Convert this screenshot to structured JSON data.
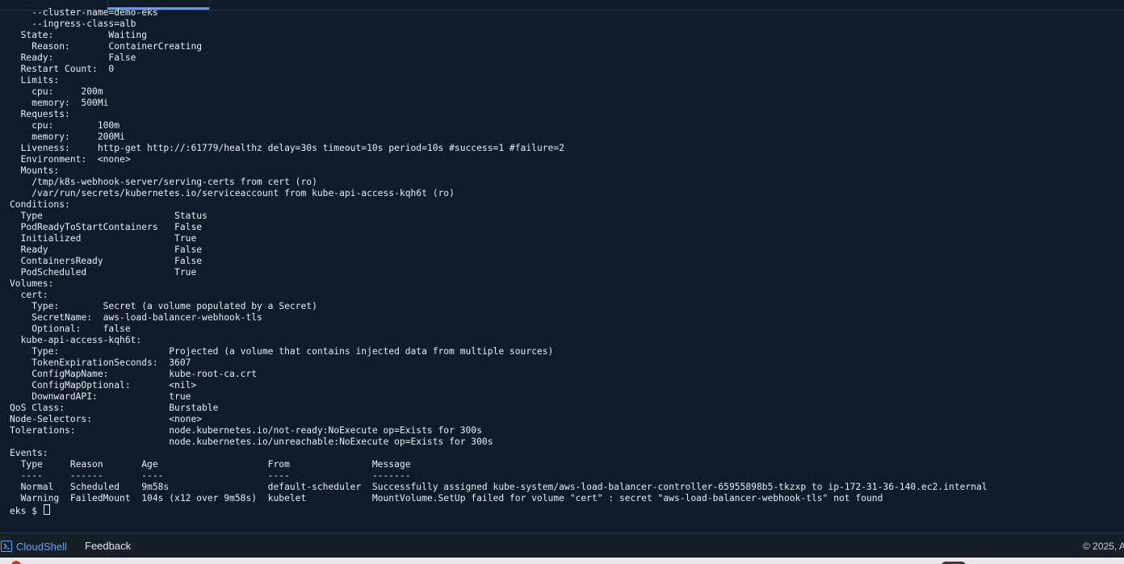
{
  "terminal": {
    "lines": [
      "    --cluster-name=demo-eks",
      "    --ingress-class=alb",
      "  State:          Waiting",
      "    Reason:       ContainerCreating",
      "  Ready:          False",
      "  Restart Count:  0",
      "  Limits:",
      "    cpu:     200m",
      "    memory:  500Mi",
      "  Requests:",
      "    cpu:        100m",
      "    memory:     200Mi",
      "  Liveness:     http-get http://:61779/healthz delay=30s timeout=10s period=10s #success=1 #failure=2",
      "  Environment:  <none>",
      "  Mounts:",
      "    /tmp/k8s-webhook-server/serving-certs from cert (ro)",
      "    /var/run/secrets/kubernetes.io/serviceaccount from kube-api-access-kqh6t (ro)",
      "Conditions:",
      "  Type                        Status",
      "  PodReadyToStartContainers   False",
      "  Initialized                 True",
      "  Ready                       False",
      "  ContainersReady             False",
      "  PodScheduled                True",
      "Volumes:",
      "  cert:",
      "    Type:        Secret (a volume populated by a Secret)",
      "    SecretName:  aws-load-balancer-webhook-tls",
      "    Optional:    false",
      "  kube-api-access-kqh6t:",
      "    Type:                    Projected (a volume that contains injected data from multiple sources)",
      "    TokenExpirationSeconds:  3607",
      "    ConfigMapName:           kube-root-ca.crt",
      "    ConfigMapOptional:       <nil>",
      "    DownwardAPI:             true",
      "QoS Class:                   Burstable",
      "Node-Selectors:              <none>",
      "Tolerations:                 node.kubernetes.io/not-ready:NoExecute op=Exists for 300s",
      "                             node.kubernetes.io/unreachable:NoExecute op=Exists for 300s",
      "Events:",
      "  Type     Reason       Age                    From               Message",
      "  ----     ------       ----                   ----               -------",
      "  Normal   Scheduled    9m58s                  default-scheduler  Successfully assigned kube-system/aws-load-balancer-controller-65955898b5-tkzxp to ip-172-31-36-140.ec2.internal",
      "  Warning  FailedMount  104s (x12 over 9m58s)  kubelet            MountVolume.SetUp failed for volume \"cert\" : secret \"aws-load-balancer-webhook-tls\" not found"
    ],
    "prompt": "eks $ "
  },
  "bottom_bar": {
    "cloudshell_label": "CloudShell",
    "feedback_label": "Feedback",
    "copyright": "© 2025, A"
  },
  "colors": {
    "background": "#0f1b2a",
    "text": "#e9edf2",
    "accent": "#5aa9ff",
    "footer": "#161e28"
  },
  "icons": {
    "cloudshell": "terminal-prompt-icon"
  }
}
